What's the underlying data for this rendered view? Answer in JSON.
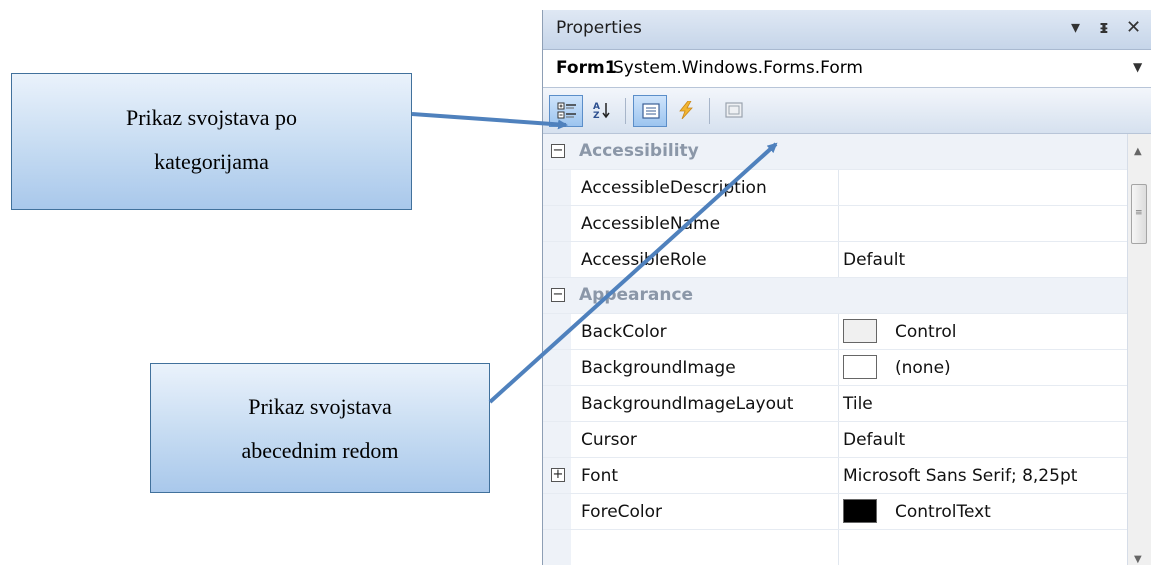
{
  "callouts": {
    "categorized": [
      "Prikaz svojstava po",
      "kategorijama"
    ],
    "alphabetical": [
      "Prikaz svojstava",
      "abecednim redom"
    ]
  },
  "panel": {
    "title": "Properties",
    "controls": {
      "dropdown": "▾",
      "pin": "ᵻ",
      "close": "✕"
    },
    "object_name": "Form1",
    "object_type": "System.Windows.Forms.Form",
    "toolbar_icons": [
      "categorized-icon",
      "alphabetical-icon",
      "properties-icon",
      "events-icon",
      "property-pages-icon"
    ]
  },
  "grid": {
    "categories": {
      "accessibility": "Accessibility",
      "appearance": "Appearance"
    },
    "rows": {
      "accessible_description": {
        "name": "AccessibleDescription",
        "value": ""
      },
      "accessible_name": {
        "name": "AccessibleName",
        "value": ""
      },
      "accessible_role": {
        "name": "AccessibleRole",
        "value": "Default"
      },
      "back_color": {
        "name": "BackColor",
        "value": "Control",
        "swatch": "#f0f0f0"
      },
      "background_image": {
        "name": "BackgroundImage",
        "value": "(none)",
        "swatch": "#ffffff"
      },
      "background_image_layout": {
        "name": "BackgroundImageLayout",
        "value": "Tile"
      },
      "cursor": {
        "name": "Cursor",
        "value": "Default"
      },
      "font": {
        "name": "Font",
        "value": "Microsoft Sans Serif; 8,25pt"
      },
      "fore_color": {
        "name": "ForeColor",
        "value": "ControlText",
        "swatch": "#000000"
      }
    }
  },
  "colors": {
    "arrow": "#4f81bd",
    "callout_border": "#41719c"
  }
}
